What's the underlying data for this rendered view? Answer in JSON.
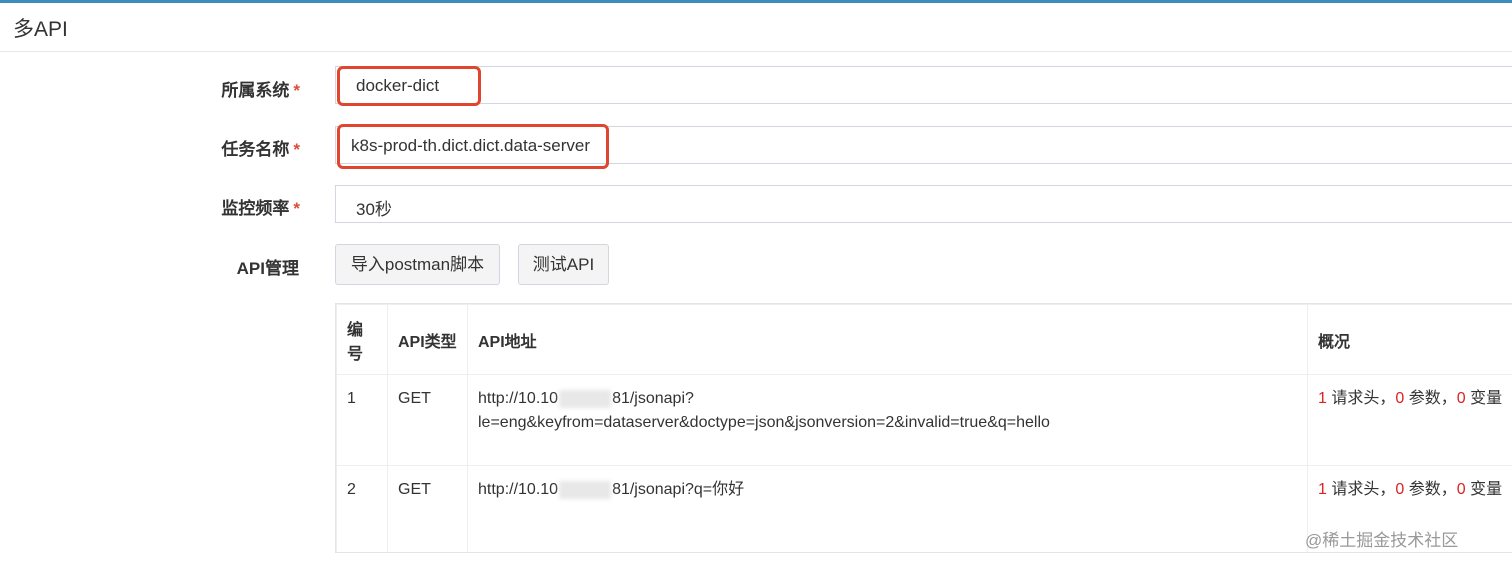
{
  "header": {
    "title": "多API"
  },
  "form": {
    "system": {
      "label": "所属系统",
      "required_mark": "*",
      "value": "docker-dict"
    },
    "task": {
      "label": "任务名称",
      "required_mark": "*",
      "value": "k8s-prod-th.dict.dict.data-server"
    },
    "interval": {
      "label": "监控频率",
      "required_mark": "*",
      "value": "30秒"
    },
    "api": {
      "label": "API管理",
      "import_button": "导入postman脚本",
      "test_button": "测试API"
    }
  },
  "table": {
    "columns": [
      "编号",
      "API类型",
      "API地址",
      "概况"
    ],
    "rows": [
      {
        "index": "1",
        "method": "GET",
        "url_prefix": "http://10.10",
        "url_suffix": "81/jsonapi?",
        "url_line2": "le=eng&keyfrom=dataserver&doctype=json&jsonversion=2&invalid=true&q=hello",
        "summary": {
          "headers": "1",
          "headers_label": "请求头，",
          "params": "0",
          "params_label": "参数，",
          "vars": "0",
          "vars_label": "变量"
        }
      },
      {
        "index": "2",
        "method": "GET",
        "url_prefix": "http://10.10",
        "url_suffix": "81/jsonapi?q=你好",
        "url_line2": "",
        "summary": {
          "headers": "1",
          "headers_label": "请求头，",
          "params": "0",
          "params_label": "参数，",
          "vars": "0",
          "vars_label": "变量"
        }
      }
    ]
  },
  "watermark": "@稀土掘金技术社区",
  "colors": {
    "accent": "#3c8dbc",
    "highlight": "#e0452f",
    "required": "#dd4b39",
    "count": "#dd2222"
  }
}
